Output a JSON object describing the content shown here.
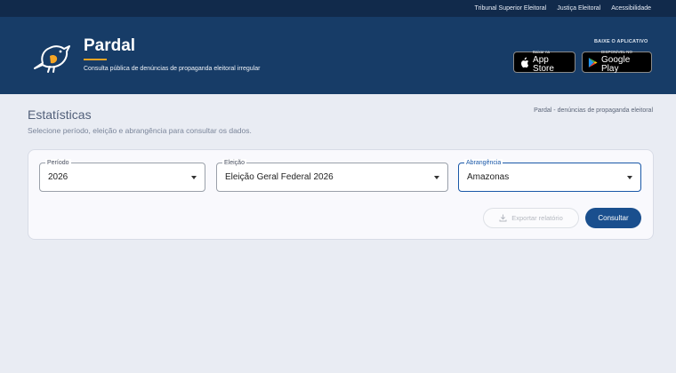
{
  "topbar": {
    "links": [
      "Tribunal Superior Eleitoral",
      "Justiça Eleitoral",
      "Acessibilidade"
    ]
  },
  "header": {
    "title": "Pardal",
    "subtitle": "Consulta pública de denúncias de propaganda eleitoral irregular",
    "app_title": "BAIXE O APLICATIVO",
    "apple": {
      "small": "Baixar na",
      "big": "App Store"
    },
    "google": {
      "small": "DISPONÍVEL NO",
      "big": "Google Play"
    }
  },
  "page": {
    "title": "Estatísticas",
    "subtitle": "Selecione período, eleição e abrangência para consultar os dados.",
    "breadcrumb": "Pardal - denúncias de propaganda eleitoral"
  },
  "form": {
    "periodo": {
      "label": "Período",
      "value": "2026"
    },
    "eleicao": {
      "label": "Eleição",
      "value": "Eleição Geral Federal 2026"
    },
    "abrangencia": {
      "label": "Abrangência",
      "value": "Amazonas"
    },
    "export_label": "Exportar relatório",
    "consultar_label": "Consultar"
  },
  "colors": {
    "header": "#173c67",
    "topbar": "#112a4b",
    "accent": "#f5a524",
    "primary": "#1a4f8e"
  },
  "icons": {
    "logo": "bird-logo-icon",
    "export": "download-icon",
    "dropdown": "caret-down-icon"
  }
}
